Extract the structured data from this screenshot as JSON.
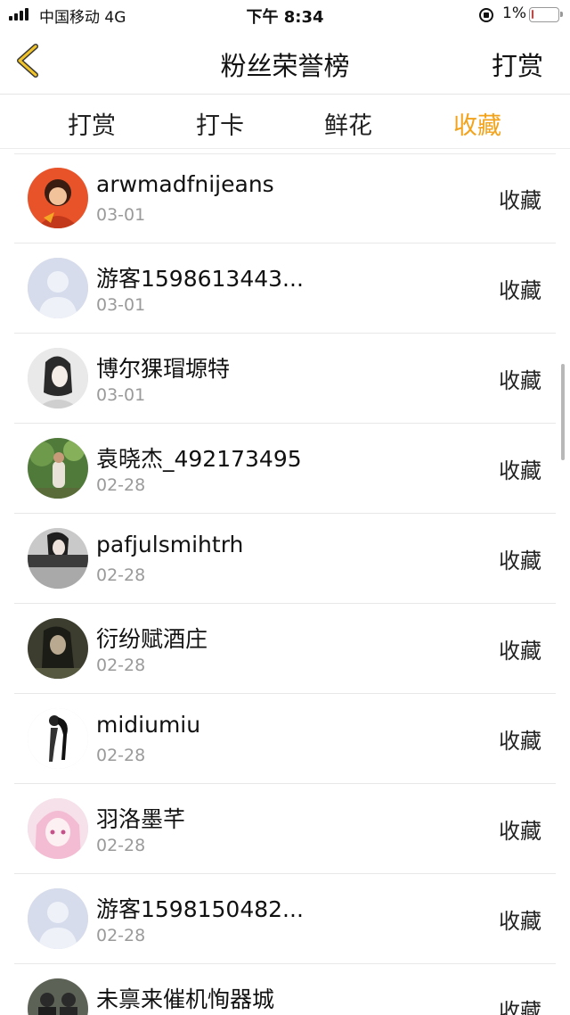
{
  "status_bar": {
    "carrier": "中国移动  4G",
    "time": "下午 8:34",
    "battery_percent": "1%",
    "battery_level": 0.01,
    "battery_color": "#e53935"
  },
  "header": {
    "back_icon": "chevron-left-icon",
    "title": "粉丝荣誉榜",
    "action_label": "打赏"
  },
  "tabs": [
    {
      "label": "打赏"
    },
    {
      "label": "打卡"
    },
    {
      "label": "鲜花"
    },
    {
      "label": "收藏",
      "active": true
    }
  ],
  "accent_color": "#f3a31b",
  "fans": [
    {
      "name": "arwmadfnijeans",
      "date": "03-01",
      "action": "收藏",
      "avatar": "cartoon-avatar"
    },
    {
      "name": "游客1598613443...",
      "date": "03-01",
      "action": "收藏",
      "avatar": "default-avatar"
    },
    {
      "name": "博尔猓瑁塬特",
      "date": "03-01",
      "action": "收藏",
      "avatar": "portrait-avatar"
    },
    {
      "name": "袁晓杰_492173495",
      "date": "02-28",
      "action": "收藏",
      "avatar": "outdoor-photo-avatar"
    },
    {
      "name": "pafjulsmihtrh",
      "date": "02-28",
      "action": "收藏",
      "avatar": "photo-avatar"
    },
    {
      "name": "衍纷赋酒庄",
      "date": "02-28",
      "action": "收藏",
      "avatar": "dark-photo-avatar"
    },
    {
      "name": "midiumiu",
      "date": "02-28",
      "action": "收藏",
      "avatar": "sketch-avatar"
    },
    {
      "name": "羽洛墨芊",
      "date": "02-28",
      "action": "收藏",
      "avatar": "anime-avatar"
    },
    {
      "name": "游客1598150482...",
      "date": "02-28",
      "action": "收藏",
      "avatar": "default-avatar"
    },
    {
      "name": "未禀来催机恂器城",
      "date": "",
      "action": "收藏",
      "avatar": "group-photo-avatar"
    }
  ]
}
